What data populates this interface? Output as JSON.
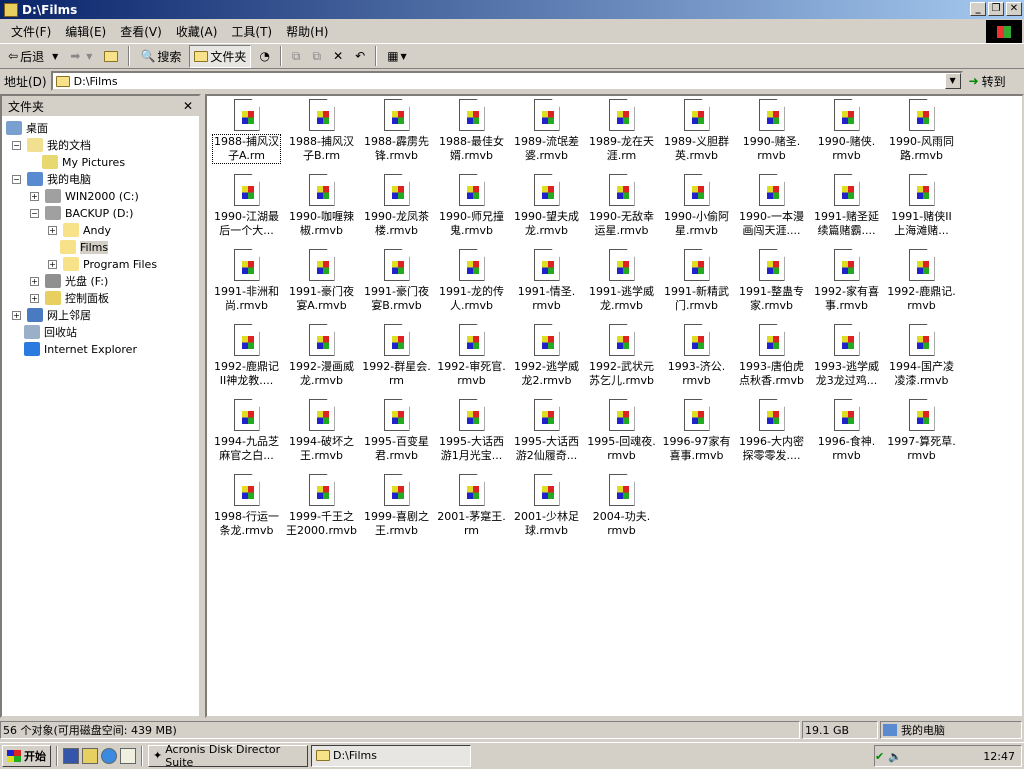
{
  "window": {
    "title": "D:\\Films"
  },
  "menu": [
    "文件(F)",
    "编辑(E)",
    "查看(V)",
    "收藏(A)",
    "工具(T)",
    "帮助(H)"
  ],
  "toolbar": {
    "back": "后退",
    "search": "搜索",
    "folders": "文件夹"
  },
  "address": {
    "label": "地址(D)",
    "value": "D:\\Films",
    "go": "转到"
  },
  "folders_pane": {
    "title": "文件夹",
    "close": "✕",
    "tree": [
      {
        "label": "桌面",
        "icon": "desktop-icon",
        "expander": ""
      },
      {
        "label": "我的文档",
        "icon": "my-documents-icon",
        "expander": "−"
      },
      {
        "label": "My Pictures",
        "icon": "my-pictures-icon",
        "expander": ""
      },
      {
        "label": "我的电脑",
        "icon": "my-computer-icon",
        "expander": "−"
      },
      {
        "label": "WIN2000 (C:)",
        "icon": "drive-icon",
        "expander": "+"
      },
      {
        "label": "BACKUP (D:)",
        "icon": "drive-icon",
        "expander": "−"
      },
      {
        "label": "Andy",
        "icon": "folder-icon",
        "expander": "+"
      },
      {
        "label": "Films",
        "icon": "folder-open-icon",
        "expander": "",
        "selected": true
      },
      {
        "label": "Program Files",
        "icon": "folder-icon",
        "expander": "+"
      },
      {
        "label": "光盘 (F:)",
        "icon": "cd-drive-icon",
        "expander": "+"
      },
      {
        "label": "控制面板",
        "icon": "control-panel-icon",
        "expander": "+"
      },
      {
        "label": "网上邻居",
        "icon": "network-icon",
        "expander": "+"
      },
      {
        "label": "回收站",
        "icon": "recycle-bin-icon",
        "expander": ""
      },
      {
        "label": "Internet Explorer",
        "icon": "ie-icon",
        "expander": ""
      }
    ]
  },
  "files": [
    "1988-捕风汉\n子A.rm",
    "1988-捕风汉\n子B.rm",
    "1988-霹雳先\n锋.rmvb",
    "1988-最佳女\n婿.rmvb",
    "1989-流氓差\n婆.rmvb",
    "1989-龙在天\n涯.rm",
    "1989-义胆群\n英.rmvb",
    "1990-赌圣.\nrmvb",
    "1990-赌侠.\nrmvb",
    "1990-风雨同\n路.rmvb",
    "1990-江湖最\n后一个大...",
    "1990-咖喱辣\n椒.rmvb",
    "1990-龙凤茶\n楼.rmvb",
    "1990-师兄撞\n鬼.rmvb",
    "1990-望夫成\n龙.rmvb",
    "1990-无敌幸\n运星.rmvb",
    "1990-小偷阿\n星.rmvb",
    "1990-一本漫\n画闯天涯....",
    "1991-赌圣延\n续篇赌霸....",
    "1991-赌侠II\n上海滩赌...",
    "1991-非洲和\n尚.rmvb",
    "1991-豪门夜\n宴A.rmvb",
    "1991-豪门夜\n宴B.rmvb",
    "1991-龙的传\n人.rmvb",
    "1991-情圣.\nrmvb",
    "1991-逃学威\n龙.rmvb",
    "1991-新精武\n门.rmvb",
    "1991-整蛊专\n家.rmvb",
    "1992-家有喜\n事.rmvb",
    "1992-鹿鼎记.\nrmvb",
    "1992-鹿鼎记\nII神龙教....",
    "1992-漫画威\n龙.rmvb",
    "1992-群星会.\nrm",
    "1992-审死官.\nrmvb",
    "1992-逃学威\n龙2.rmvb",
    "1992-武状元\n苏乞儿.rmvb",
    "1993-济公.\nrmvb",
    "1993-唐伯虎\n点秋香.rmvb",
    "1993-逃学威\n龙3龙过鸡...",
    "1994-国产凌\n凌漆.rmvb",
    "1994-九品芝\n麻官之白...",
    "1994-破坏之\n王.rmvb",
    "1995-百变星\n君.rmvb",
    "1995-大话西\n游1月光宝...",
    "1995-大话西\n游2仙履奇...",
    "1995-回魂夜.\nrmvb",
    "1996-97家有\n喜事.rmvb",
    "1996-大内密\n探零零发....",
    "1996-食神.\nrmvb",
    "1997-算死草.\nrmvb",
    "1998-行运一\n条龙.rmvb",
    "1999-千王之\n王2000.rmvb",
    "1999-喜剧之\n王.rmvb",
    "2001-茅寔王.\nrm",
    "2001-少林足\n球.rmvb",
    "2004-功夫.\nrmvb"
  ],
  "status": {
    "objects": "56 个对象(可用磁盘空间: 439 MB)",
    "size": "19.1 GB",
    "zone": "我的电脑"
  },
  "taskbar": {
    "start": "开始",
    "tasks": [
      "Acronis Disk Director Suite",
      "D:\\Films"
    ],
    "clock": "12:47"
  },
  "colors": {
    "title_start": "#0a246a",
    "title_end": "#a6caf0",
    "face": "#d4d0c8"
  }
}
